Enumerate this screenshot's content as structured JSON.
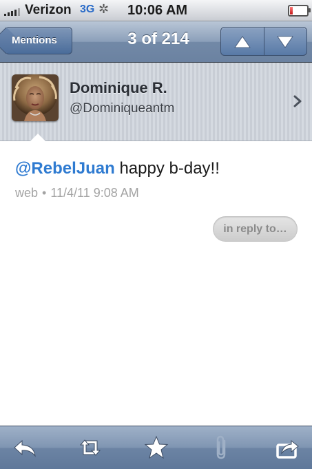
{
  "status_bar": {
    "carrier": "Verizon",
    "network": "3G",
    "time": "10:06 AM",
    "battery_level": 0.15,
    "signal_bars": 5
  },
  "nav": {
    "back_label": "Mentions",
    "title": "3 of 214",
    "up_icon": "arrow-up-icon",
    "down_icon": "arrow-down-icon"
  },
  "profile": {
    "display_name": "Dominique R.",
    "screen_name": "@Dominiqueantm"
  },
  "tweet": {
    "mention": "@RebelJuan",
    "text": "happy b-day!!",
    "source": "web",
    "separator": "•",
    "timestamp": "11/4/11 9:08 AM",
    "reply_label": "in reply to…"
  },
  "toolbar": {
    "items": [
      "reply-icon",
      "retweet-icon",
      "favorite-star-icon",
      "attachment-paperclip-icon",
      "share-icon"
    ]
  },
  "colors": {
    "link": "#2f7bd1",
    "nav_bar": "#7d92ae",
    "meta_text": "#a3a3a3"
  }
}
